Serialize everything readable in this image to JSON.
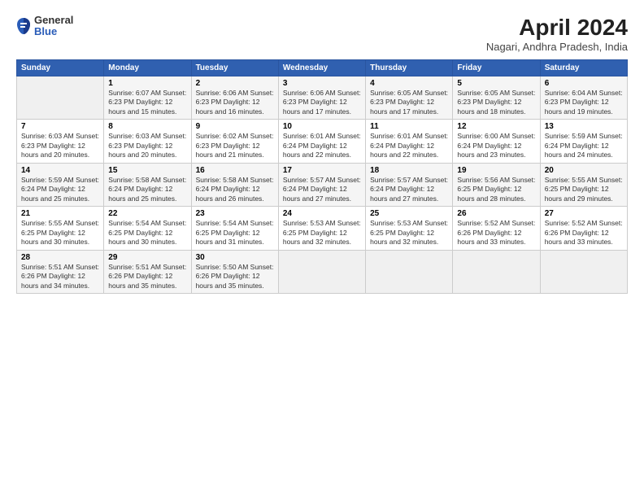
{
  "header": {
    "logo": {
      "general": "General",
      "blue": "Blue"
    },
    "title": "April 2024",
    "subtitle": "Nagari, Andhra Pradesh, India"
  },
  "calendar": {
    "days_of_week": [
      "Sunday",
      "Monday",
      "Tuesday",
      "Wednesday",
      "Thursday",
      "Friday",
      "Saturday"
    ],
    "weeks": [
      [
        {
          "day": "",
          "info": ""
        },
        {
          "day": "1",
          "info": "Sunrise: 6:07 AM\nSunset: 6:23 PM\nDaylight: 12 hours\nand 15 minutes."
        },
        {
          "day": "2",
          "info": "Sunrise: 6:06 AM\nSunset: 6:23 PM\nDaylight: 12 hours\nand 16 minutes."
        },
        {
          "day": "3",
          "info": "Sunrise: 6:06 AM\nSunset: 6:23 PM\nDaylight: 12 hours\nand 17 minutes."
        },
        {
          "day": "4",
          "info": "Sunrise: 6:05 AM\nSunset: 6:23 PM\nDaylight: 12 hours\nand 17 minutes."
        },
        {
          "day": "5",
          "info": "Sunrise: 6:05 AM\nSunset: 6:23 PM\nDaylight: 12 hours\nand 18 minutes."
        },
        {
          "day": "6",
          "info": "Sunrise: 6:04 AM\nSunset: 6:23 PM\nDaylight: 12 hours\nand 19 minutes."
        }
      ],
      [
        {
          "day": "7",
          "info": "Sunrise: 6:03 AM\nSunset: 6:23 PM\nDaylight: 12 hours\nand 20 minutes."
        },
        {
          "day": "8",
          "info": "Sunrise: 6:03 AM\nSunset: 6:23 PM\nDaylight: 12 hours\nand 20 minutes."
        },
        {
          "day": "9",
          "info": "Sunrise: 6:02 AM\nSunset: 6:23 PM\nDaylight: 12 hours\nand 21 minutes."
        },
        {
          "day": "10",
          "info": "Sunrise: 6:01 AM\nSunset: 6:24 PM\nDaylight: 12 hours\nand 22 minutes."
        },
        {
          "day": "11",
          "info": "Sunrise: 6:01 AM\nSunset: 6:24 PM\nDaylight: 12 hours\nand 22 minutes."
        },
        {
          "day": "12",
          "info": "Sunrise: 6:00 AM\nSunset: 6:24 PM\nDaylight: 12 hours\nand 23 minutes."
        },
        {
          "day": "13",
          "info": "Sunrise: 5:59 AM\nSunset: 6:24 PM\nDaylight: 12 hours\nand 24 minutes."
        }
      ],
      [
        {
          "day": "14",
          "info": "Sunrise: 5:59 AM\nSunset: 6:24 PM\nDaylight: 12 hours\nand 25 minutes."
        },
        {
          "day": "15",
          "info": "Sunrise: 5:58 AM\nSunset: 6:24 PM\nDaylight: 12 hours\nand 25 minutes."
        },
        {
          "day": "16",
          "info": "Sunrise: 5:58 AM\nSunset: 6:24 PM\nDaylight: 12 hours\nand 26 minutes."
        },
        {
          "day": "17",
          "info": "Sunrise: 5:57 AM\nSunset: 6:24 PM\nDaylight: 12 hours\nand 27 minutes."
        },
        {
          "day": "18",
          "info": "Sunrise: 5:57 AM\nSunset: 6:24 PM\nDaylight: 12 hours\nand 27 minutes."
        },
        {
          "day": "19",
          "info": "Sunrise: 5:56 AM\nSunset: 6:25 PM\nDaylight: 12 hours\nand 28 minutes."
        },
        {
          "day": "20",
          "info": "Sunrise: 5:55 AM\nSunset: 6:25 PM\nDaylight: 12 hours\nand 29 minutes."
        }
      ],
      [
        {
          "day": "21",
          "info": "Sunrise: 5:55 AM\nSunset: 6:25 PM\nDaylight: 12 hours\nand 30 minutes."
        },
        {
          "day": "22",
          "info": "Sunrise: 5:54 AM\nSunset: 6:25 PM\nDaylight: 12 hours\nand 30 minutes."
        },
        {
          "day": "23",
          "info": "Sunrise: 5:54 AM\nSunset: 6:25 PM\nDaylight: 12 hours\nand 31 minutes."
        },
        {
          "day": "24",
          "info": "Sunrise: 5:53 AM\nSunset: 6:25 PM\nDaylight: 12 hours\nand 32 minutes."
        },
        {
          "day": "25",
          "info": "Sunrise: 5:53 AM\nSunset: 6:25 PM\nDaylight: 12 hours\nand 32 minutes."
        },
        {
          "day": "26",
          "info": "Sunrise: 5:52 AM\nSunset: 6:26 PM\nDaylight: 12 hours\nand 33 minutes."
        },
        {
          "day": "27",
          "info": "Sunrise: 5:52 AM\nSunset: 6:26 PM\nDaylight: 12 hours\nand 33 minutes."
        }
      ],
      [
        {
          "day": "28",
          "info": "Sunrise: 5:51 AM\nSunset: 6:26 PM\nDaylight: 12 hours\nand 34 minutes."
        },
        {
          "day": "29",
          "info": "Sunrise: 5:51 AM\nSunset: 6:26 PM\nDaylight: 12 hours\nand 35 minutes."
        },
        {
          "day": "30",
          "info": "Sunrise: 5:50 AM\nSunset: 6:26 PM\nDaylight: 12 hours\nand 35 minutes."
        },
        {
          "day": "",
          "info": ""
        },
        {
          "day": "",
          "info": ""
        },
        {
          "day": "",
          "info": ""
        },
        {
          "day": "",
          "info": ""
        }
      ]
    ]
  }
}
